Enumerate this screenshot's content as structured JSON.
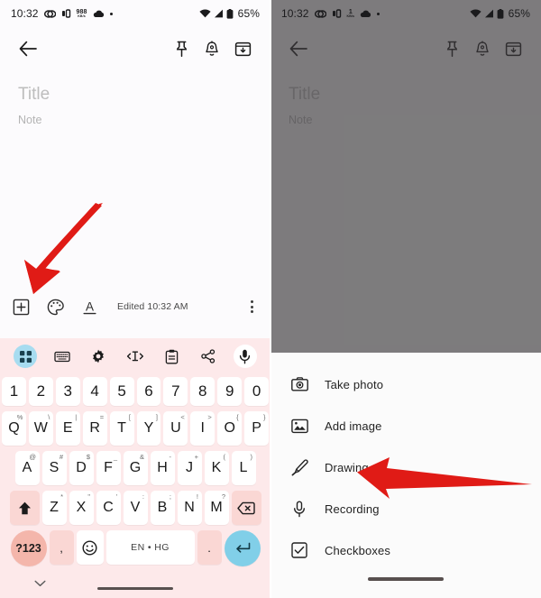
{
  "screens": [
    {
      "id": "left",
      "status_bar": {
        "time": "10:32",
        "network_speed_value": "988",
        "network_speed_unit": "KB/s",
        "battery_percent": "65%",
        "icons": [
          "sync-icon",
          "vibrate-icon",
          "network-speed-icon",
          "cloud-icon",
          "dot-icon",
          "wifi-icon",
          "signal-icon",
          "battery-icon"
        ]
      },
      "app_bar": {
        "back_label": "Back",
        "actions": [
          {
            "name": "pin-icon",
            "label": "Pin"
          },
          {
            "name": "reminder-bell-icon",
            "label": "Reminder"
          },
          {
            "name": "archive-icon",
            "label": "Archive"
          }
        ]
      },
      "note": {
        "title_placeholder": "Title",
        "body_placeholder": "Note"
      },
      "note_toolbar": {
        "add_label": "Add",
        "palette_label": "Background options",
        "format_label": "Formatting options",
        "edited_text": "Edited 10:32 AM",
        "more_label": "More"
      },
      "keyboard": {
        "toolbar": [
          {
            "name": "grid-apps-icon",
            "label": "Apps",
            "active": true
          },
          {
            "name": "keyboard-icon",
            "label": "Keyboard",
            "active": false
          },
          {
            "name": "settings-gear-icon",
            "label": "Settings",
            "active": false
          },
          {
            "name": "text-edit-icon",
            "label": "Text editing",
            "active": false
          },
          {
            "name": "clipboard-icon",
            "label": "Clipboard",
            "active": false
          },
          {
            "name": "share-icon",
            "label": "Share",
            "active": false
          },
          {
            "name": "microphone-icon",
            "label": "Voice input",
            "active": false
          }
        ],
        "row_numbers": [
          "1",
          "2",
          "3",
          "4",
          "5",
          "6",
          "7",
          "8",
          "9",
          "0"
        ],
        "row_q": [
          {
            "main": "Q",
            "sup": "%"
          },
          {
            "main": "W",
            "sup": "\\"
          },
          {
            "main": "E",
            "sup": "|"
          },
          {
            "main": "R",
            "sup": "="
          },
          {
            "main": "T",
            "sup": "["
          },
          {
            "main": "Y",
            "sup": "]"
          },
          {
            "main": "U",
            "sup": "<"
          },
          {
            "main": "I",
            "sup": ">"
          },
          {
            "main": "O",
            "sup": "{"
          },
          {
            "main": "P",
            "sup": "}"
          }
        ],
        "row_a": [
          {
            "main": "A",
            "sup": "@"
          },
          {
            "main": "S",
            "sup": "#"
          },
          {
            "main": "D",
            "sup": "$"
          },
          {
            "main": "F",
            "sup": "_"
          },
          {
            "main": "G",
            "sup": "&"
          },
          {
            "main": "H",
            "sup": "-"
          },
          {
            "main": "J",
            "sup": "+"
          },
          {
            "main": "K",
            "sup": "("
          },
          {
            "main": "L",
            "sup": ")"
          }
        ],
        "row_z": [
          {
            "main": "Z",
            "sup": "*"
          },
          {
            "main": "X",
            "sup": "\""
          },
          {
            "main": "C",
            "sup": "'"
          },
          {
            "main": "V",
            "sup": ":"
          },
          {
            "main": "B",
            "sup": ";"
          },
          {
            "main": "N",
            "sup": "!"
          },
          {
            "main": "M",
            "sup": "?"
          }
        ],
        "shift_label": "Shift",
        "backspace_label": "Backspace",
        "symbols_key": "?123",
        "comma_key": ",",
        "emoji_label": "Emoji",
        "space_label": "EN • HG",
        "period_key": ".",
        "enter_label": "Enter",
        "hide_keyboard_label": "Hide keyboard"
      },
      "annotation": {
        "arrow_label": "red-arrow-pointing-to-add-button"
      }
    },
    {
      "id": "right",
      "status_bar": {
        "time": "10:32",
        "network_speed_value": "1",
        "network_speed_unit": "KB/s",
        "battery_percent": "65%"
      },
      "app_bar": {
        "back_label": "Back",
        "actions": [
          {
            "name": "pin-icon",
            "label": "Pin"
          },
          {
            "name": "reminder-bell-icon",
            "label": "Reminder"
          },
          {
            "name": "archive-icon",
            "label": "Archive"
          }
        ]
      },
      "note": {
        "title_placeholder": "Title",
        "body_placeholder": "Note"
      },
      "sheet": {
        "items": [
          {
            "icon": "camera-icon",
            "label": "Take photo"
          },
          {
            "icon": "image-icon",
            "label": "Add image"
          },
          {
            "icon": "pencil-brush-icon",
            "label": "Drawing"
          },
          {
            "icon": "microphone-icon",
            "label": "Recording"
          },
          {
            "icon": "checkbox-icon",
            "label": "Checkboxes"
          }
        ]
      },
      "annotation": {
        "arrow_label": "red-arrow-pointing-to-add-image"
      }
    }
  ],
  "colors": {
    "keyboard_bg": "#fde9ea",
    "key_bg": "#ffffff",
    "modifier_key_bg": "#fad7d4",
    "symbols_key_bg": "#f4b6ab",
    "enter_key_bg": "#81cfe8",
    "toolbar_active_bg": "#a7dcf0",
    "arrow_red": "#e01b16",
    "dim_overlay": "#3c3a3c"
  }
}
